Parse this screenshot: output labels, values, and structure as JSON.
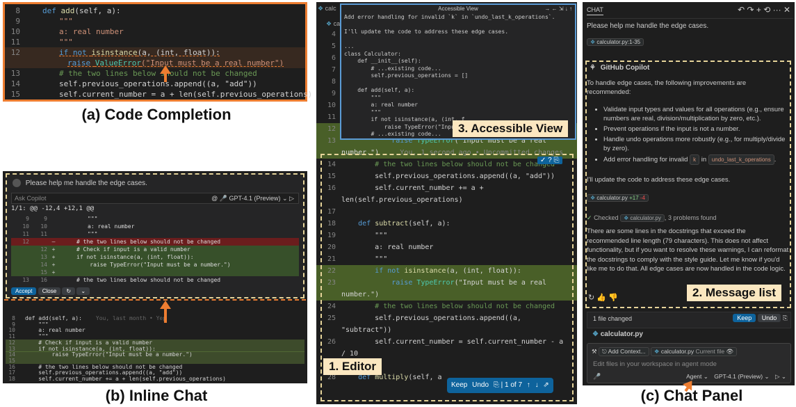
{
  "captions": {
    "a": "(a) Code Completion",
    "b": "(b) Inline Chat",
    "c": "(c) Chat Panel"
  },
  "panel_a": {
    "lines": [
      {
        "n": "8",
        "html_key": "a8"
      },
      {
        "n": "9"
      },
      {
        "n": "10"
      },
      {
        "n": "11"
      },
      {
        "n": "12"
      },
      {
        "n": "13"
      },
      {
        "n": "14"
      },
      {
        "n": "15"
      }
    ],
    "code": {
      "a8_def": "def ",
      "a8_fn": "add",
      "a8_rest": "(self, a):",
      "a9": "\"\"\"",
      "a10": "a: real number",
      "a11": "\"\"\"",
      "a12_if": "if not ",
      "a12_fn": "isinstance",
      "a12_rest": "(a, (int, float)):",
      "a_ghost_raise": "raise ",
      "a_ghost_type": "ValueError",
      "a_ghost_str": "(\"Input must be a real number\")",
      "a13": "# the two lines below should not be changed",
      "a14": "self.previous_operations.append((a, \"add\"))",
      "a15": "self.current_number = a + len(self.previous_operations)"
    }
  },
  "panel_b": {
    "prompt": "Please help me handle the edge cases.",
    "input_placeholder": "Ask Copilot",
    "model": "GPT-4.1 (Preview)",
    "diff_header": "1/1: @@ -12,4 +12,1 @@",
    "diff": [
      {
        "o": "9",
        "n": "9",
        "s": "",
        "t": "\"\"\"",
        "k": "ctx"
      },
      {
        "o": "10",
        "n": "10",
        "s": "",
        "t": "a: real number",
        "k": "ctx"
      },
      {
        "o": "11",
        "n": "11",
        "s": "",
        "t": "\"\"\"",
        "k": "ctx"
      },
      {
        "o": "12",
        "n": "",
        "s": "–",
        "t": "# the two lines below should not be changed",
        "k": "del"
      },
      {
        "o": "",
        "n": "12",
        "s": "+",
        "t": "# Check if input is a valid number",
        "k": "add"
      },
      {
        "o": "",
        "n": "13",
        "s": "+",
        "t": "if not isinstance(a, (int, float)):",
        "k": "add"
      },
      {
        "o": "",
        "n": "14",
        "s": "+",
        "t": "    raise TypeError(\"Input must be a number.\")",
        "k": "add"
      },
      {
        "o": "",
        "n": "15",
        "s": "+",
        "t": "",
        "k": "add"
      },
      {
        "o": "13",
        "n": "16",
        "s": "",
        "t": "# the two lines below should not be changed",
        "k": "ctx"
      }
    ],
    "accept": "Accept",
    "close": "Close",
    "editor_lines": [
      {
        "n": "8",
        "t": "def add(self, a):",
        "blame": "You, last month • Yep"
      },
      {
        "n": "9",
        "t": "    \"\"\""
      },
      {
        "n": "10",
        "t": "    a: real number"
      },
      {
        "n": "11",
        "t": "    \"\"\""
      },
      {
        "n": "12",
        "t": "    # Check if input is a valid number"
      },
      {
        "n": "13",
        "t": "    if not isinstance(a, (int, float)):"
      },
      {
        "n": "14",
        "t": "        raise TypeError(\"Input must be a number.\")"
      },
      {
        "n": "15",
        "t": ""
      },
      {
        "n": "16",
        "t": "    # the two lines below should not be changed"
      },
      {
        "n": "17",
        "t": "    self.previous_operations.append((a, \"add\"))"
      },
      {
        "n": "18",
        "t": "    self.current_number += a + len(self.previous_operations)"
      }
    ]
  },
  "panel_editor": {
    "tab1": "calc",
    "tab2": "ca",
    "accessible": {
      "title": "Accessible View",
      "lines": [
        "Add error handling for invalid `k` in `undo_last_k_operations`.",
        "",
        "I'll update the code to address these edge cases.",
        "",
        "...",
        "class Calculator:",
        "    def __init__(self):",
        "        # ...existing code...",
        "        self.previous_operations = []",
        "",
        "    def add(self, a):",
        "        \"\"\"",
        "        a: real number",
        "        \"\"\"",
        "        if not isinstance(a, (int, f",
        "            raise TypeError(\"Input m",
        "        # ...existing code..."
      ]
    },
    "label_editor": "1. Editor",
    "label_accessible": "3. Accessible View",
    "lines": [
      {
        "n": "4",
        "t": ""
      },
      {
        "n": "5",
        "t": ""
      },
      {
        "n": "6",
        "t": ""
      },
      {
        "n": "7",
        "t": ""
      },
      {
        "n": "8",
        "t": ""
      },
      {
        "n": "9",
        "t": ""
      },
      {
        "n": "10",
        "t": "        a: real number"
      },
      {
        "n": "11",
        "t": "        \"\"\""
      },
      {
        "n": "12",
        "t": "        if not isinstance(a, (int, float)):",
        "hl": true
      },
      {
        "n": "13",
        "t": "            raise TypeError(\"Input must be a real",
        "hl": true
      },
      {
        "n": "",
        "t": "number.\")     You, 1 second ago • Uncommitted changes",
        "hl": true
      },
      {
        "n": "14",
        "t": "        # the two lines below should not be changed"
      },
      {
        "n": "15",
        "t": "        self.previous_operations.append((a, \"add\"))"
      },
      {
        "n": "16",
        "t": "        self.current_number += a +"
      },
      {
        "n": "",
        "t": "len(self.previous_operations)"
      },
      {
        "n": "17",
        "t": ""
      },
      {
        "n": "18",
        "t": "    def subtract(self, a):"
      },
      {
        "n": "19",
        "t": "        \"\"\""
      },
      {
        "n": "20",
        "t": "        a: real number"
      },
      {
        "n": "21",
        "t": "        \"\"\""
      },
      {
        "n": "22",
        "t": "        if not isinstance(a, (int, float)):",
        "hl": true
      },
      {
        "n": "23",
        "t": "            raise TypeError(\"Input must be a real",
        "hl": true
      },
      {
        "n": "",
        "t": "number.\")",
        "hl": true
      },
      {
        "n": "24",
        "t": "        # the two lines below should not be changed"
      },
      {
        "n": "25",
        "t": "        self.previous_operations.append((a,"
      },
      {
        "n": "",
        "t": "\"subtract\"))"
      },
      {
        "n": "26",
        "t": "        self.current_number = self.current_number - a"
      },
      {
        "n": "",
        "t": "/ 10"
      },
      {
        "n": "27",
        "t": ""
      },
      {
        "n": "28",
        "t": "    def multiply(self, a"
      }
    ],
    "float_keep": "Keep",
    "float_undo": "Undo",
    "float_count": "1 of 7"
  },
  "panel_chat": {
    "header": "CHAT",
    "user_msg": "Please help me handle the edge cases.",
    "ref_file": "calculator.py:1-35",
    "assistant": "GitHub Copilot",
    "intro": "To handle edge cases, the following improvements are recommended:",
    "bullets": [
      "Validate input types and values for all operations (e.g., ensure numbers are real, division/multiplication by zero, etc.).",
      "Prevent operations if the input is not a number.",
      "Handle undo operations more robustly (e.g., for multiply/divide by zero).",
      "Add error handling for invalid"
    ],
    "bullet_k": "k",
    "bullet_in": "in",
    "bullet_fn": "undo_last_k_operations",
    "update": "I'll update the code to address these edge cases.",
    "file_chip": "calculator.py",
    "plus": "+17",
    "minus": "-4",
    "checked": "Checked",
    "checked_file": "calculator.py",
    "problems": ", 3 problems found",
    "note": "There are some lines in the docstrings that exceed the recommended line length (79 characters). This does not affect functionality, but if you want to resolve these warnings, I can reformat the docstrings to comply with the style guide. Let me know if you'd like me to do that. All edge cases are now handled in the code logic.",
    "label_msg": "2. Message list",
    "files_changed": "1 file changed",
    "keep": "Keep",
    "undo": "Undo",
    "changed_file": "calculator.py",
    "add_context": "Add Context...",
    "current_file": "calculator.py",
    "current_file_tag": "Current file",
    "input_placeholder": "Edit files in your workspace in agent mode",
    "mode": "Agent",
    "model": "GPT-4.1 (Preview)"
  }
}
